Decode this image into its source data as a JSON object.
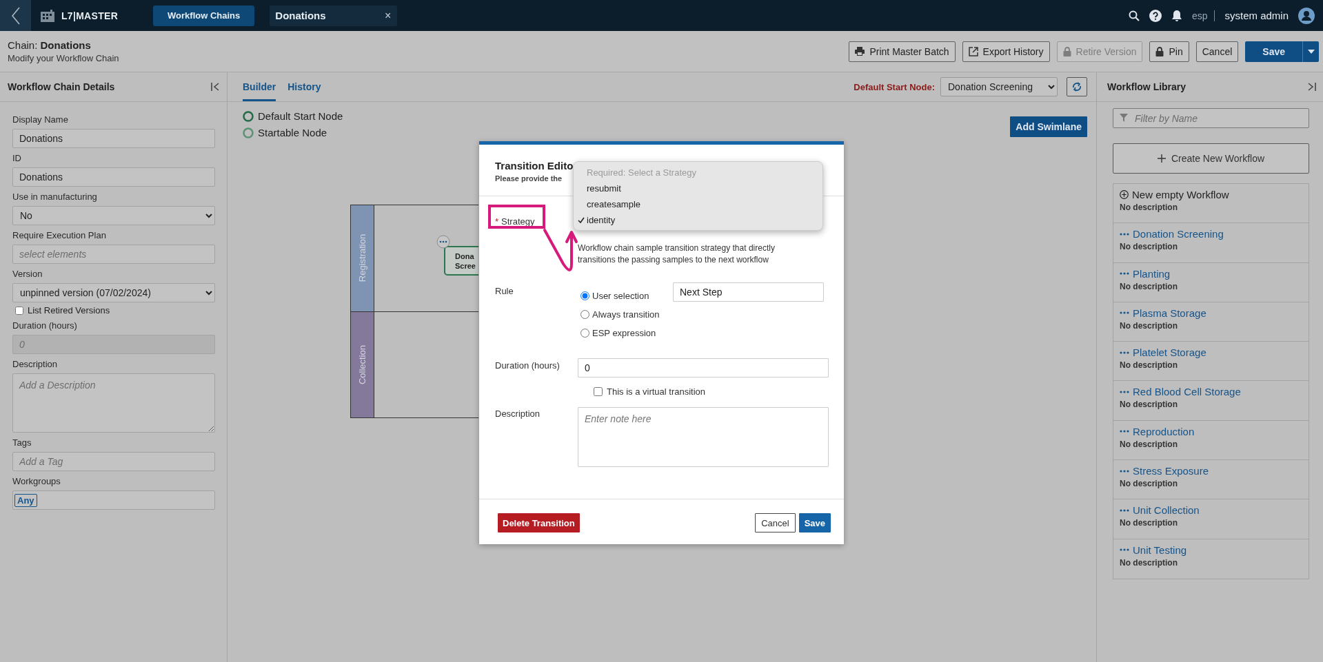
{
  "top_bar": {
    "app_name": "L7|MASTER",
    "tabs": [
      {
        "label": "Workflow Chains",
        "kind": "section"
      },
      {
        "label": "Donations",
        "kind": "document",
        "close": "×"
      }
    ],
    "org": "esp",
    "user": "system admin"
  },
  "header": {
    "title": "Chain: **Donations**",
    "subtitle": "Modify your Workflow Chain",
    "actions": [
      {
        "label": "Print Master Batch",
        "disabled": false
      },
      {
        "label": "Export History",
        "disabled": false
      },
      {
        "label": "Retire Version",
        "disabled": true
      },
      {
        "label": "Pin",
        "disabled": false
      },
      {
        "label": "Cancel",
        "disabled": false
      }
    ],
    "save": "Save"
  },
  "details_panel": {
    "title": "Workflow Chain Details",
    "fields": [
      {
        "kind": "text",
        "label": "Display Name",
        "value": "Donations"
      },
      {
        "kind": "text",
        "label": "ID",
        "value": "Donations"
      },
      {
        "kind": "select",
        "label": "Use in manufacturing",
        "value": "No"
      },
      {
        "kind": "text",
        "label": "Require Execution Plan",
        "placeholder": "select elements"
      },
      {
        "kind": "select",
        "label": "Version",
        "value": "unpinned version (07/02/2024)"
      },
      {
        "kind": "checkbox",
        "label": "List Retired Versions",
        "checked": false
      },
      {
        "kind": "text",
        "label": "Duration (hours)",
        "placeholder": "0",
        "disabled": true
      },
      {
        "kind": "textarea",
        "label": "Description",
        "placeholder": "Add a Description"
      },
      {
        "kind": "text",
        "label": "Tags",
        "placeholder": "Add a Tag"
      },
      {
        "kind": "tags",
        "label": "Workgroups",
        "tags": [
          "Any"
        ]
      }
    ]
  },
  "builder": {
    "tabs": [
      {
        "label": "Builder",
        "selected": true
      },
      {
        "label": "History",
        "selected": false
      }
    ],
    "start_node_label": "Default Start Node:",
    "start_node_value": "Donation Screening",
    "legend": [
      {
        "label": "Default Start Node",
        "kind": "default"
      },
      {
        "label": "Startable Node",
        "kind": "startable"
      }
    ],
    "add_swimlane": "Add Swimlane",
    "swimlanes": [
      {
        "label": "Registration",
        "color": "#7f93b3"
      },
      {
        "label": "Collection",
        "color": "#85799b"
      }
    ],
    "nodes": [
      {
        "lines": [
          "Dona",
          "Scree"
        ]
      }
    ]
  },
  "library": {
    "title": "Workflow Library",
    "filter_placeholder": "Filter by Name",
    "create": "Create New Workflow",
    "items": [
      {
        "kind": "new",
        "name": "New empty Workflow",
        "description": "No description"
      },
      {
        "kind": "workflow",
        "name": "Donation Screening",
        "description": "No description"
      },
      {
        "kind": "workflow",
        "name": "Planting",
        "description": "No description"
      },
      {
        "kind": "workflow",
        "name": "Plasma Storage",
        "description": "No description"
      },
      {
        "kind": "workflow",
        "name": "Platelet Storage",
        "description": "No description"
      },
      {
        "kind": "workflow",
        "name": "Red Blood Cell Storage",
        "description": "No description"
      },
      {
        "kind": "workflow",
        "name": "Reproduction",
        "description": "No description"
      },
      {
        "kind": "workflow",
        "name": "Stress Exposure",
        "description": "No description"
      },
      {
        "kind": "workflow",
        "name": "Unit Collection",
        "description": "No description"
      },
      {
        "kind": "workflow",
        "name": "Unit Testing",
        "description": "No description"
      }
    ]
  },
  "modal": {
    "title": "Transition Edito",
    "subtitle": "Please provide the",
    "strategy": {
      "label": "Strategy",
      "required_mark": "*",
      "options": [
        {
          "label": "Required: Select a Strategy",
          "kind": "placeholder",
          "selected": false
        },
        {
          "label": "resubmit",
          "kind": "option",
          "selected": false
        },
        {
          "label": "createsample",
          "kind": "option",
          "selected": false
        },
        {
          "label": "identity",
          "kind": "option",
          "selected": true
        }
      ],
      "help": "Workflow chain sample transition strategy that directly transitions the passing samples to the next workflow"
    },
    "rule": {
      "label": "Rule",
      "options": [
        {
          "label": "User selection",
          "selected": true
        },
        {
          "label": "Always transition",
          "selected": false
        },
        {
          "label": "ESP expression",
          "selected": false
        }
      ],
      "value": "Next Step"
    },
    "duration": {
      "label": "Duration (hours)",
      "value": "0"
    },
    "virtual": {
      "label": "This is a virtual transition",
      "checked": false
    },
    "description": {
      "label": "Description",
      "placeholder": "Enter note here"
    },
    "delete": "Delete Transition",
    "cancel": "Cancel",
    "save": "Save",
    "annotation": {
      "kind": "frame_with_arrow"
    }
  }
}
